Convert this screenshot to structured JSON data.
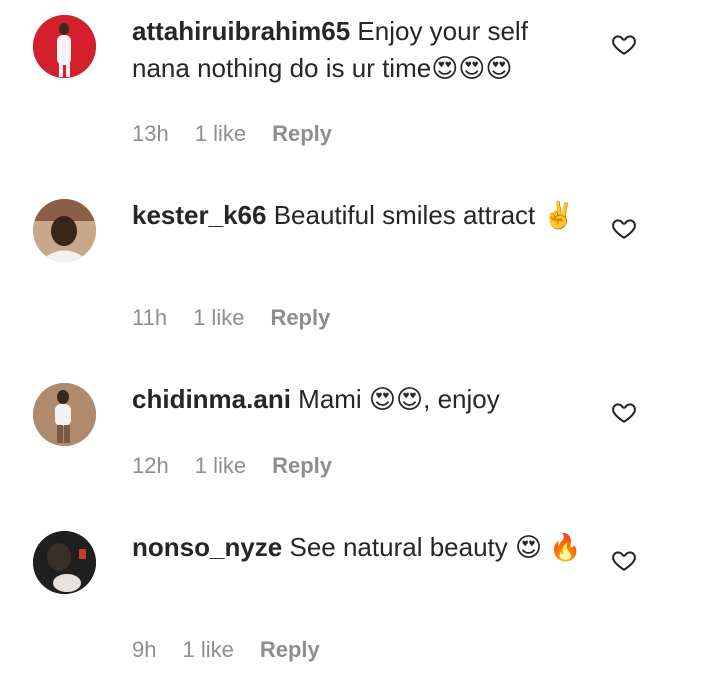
{
  "comments": [
    {
      "username": "attahiruibrahim65",
      "text": "Enjoy your self nana nothing do is ur time😍😍😍",
      "time": "13h",
      "likes": "1 like",
      "reply_label": "Reply",
      "avatar_bg": "#d4202c"
    },
    {
      "username": "kester_k66",
      "text": "Beautiful smiles attract ✌️",
      "time": "11h",
      "likes": "1 like",
      "reply_label": "Reply",
      "avatar_bg": "#b98d6c"
    },
    {
      "username": "chidinma.ani",
      "text": "Mami 😍😍, enjoy",
      "time": "12h",
      "likes": "1 like",
      "reply_label": "Reply",
      "avatar_bg": "#a47d63"
    },
    {
      "username": "nonso_nyze",
      "text": "See natural beauty 😍 🔥",
      "time": "9h",
      "likes": "1 like",
      "reply_label": "Reply",
      "avatar_bg": "#222222"
    }
  ],
  "icons": {
    "like": "heart-outline-icon"
  },
  "colors": {
    "text": "#262626",
    "secondary": "#8e8e8e"
  }
}
